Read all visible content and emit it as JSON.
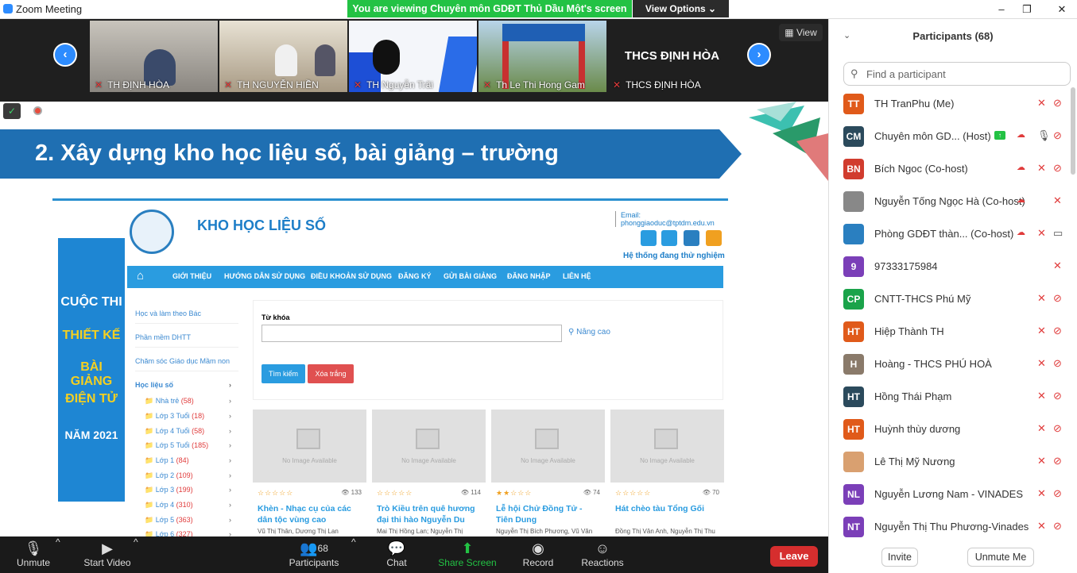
{
  "window": {
    "title": "Zoom Meeting",
    "minimize": "–",
    "maximize": "❐",
    "close": "✕"
  },
  "banner": {
    "text": "You are viewing Chuyên môn GDĐT Thủ Dầu Một's screen",
    "view_options": "View Options ⌄"
  },
  "strip": {
    "view_label": "View",
    "thumbs": [
      {
        "name": "TH ĐỊNH HÒA"
      },
      {
        "name": "TH NGUYỄN HIỀN"
      },
      {
        "name": "TH Nguyễn Trãi"
      },
      {
        "name": "Th Le Thi Hong Gam"
      },
      {
        "name": "THCS ĐỊNH HÒA",
        "big": "THCS ĐỊNH HÒA"
      }
    ]
  },
  "slide": {
    "heading": "2. Xây dựng kho học liệu số, bài giảng – trường",
    "site": {
      "title": "KHO HỌC LIỆU SỐ",
      "email": "Email: phonggiaoduc@tptdm.edu.vn",
      "trial": "Hệ thống đang thử nghiệm",
      "nav": [
        "GIỚI THIỆU",
        "HƯỚNG DẪN SỬ DỤNG",
        "ĐIỀU KHOẢN SỬ DỤNG",
        "ĐĂNG KÝ",
        "GỬI BÀI GIẢNG",
        "ĐĂNG NHẬP",
        "LIÊN HỆ"
      ],
      "banner_lines": [
        "CUỘC THI",
        "THIẾT KẾ",
        "BÀI GIẢNG",
        "ĐIỆN TỬ",
        "NĂM 2021"
      ],
      "left_menu": [
        "Học và làm theo Bác",
        "Phần mềm DHTT",
        "Chăm sóc Giáo dục Mầm non"
      ],
      "cat_title": "Học liệu số",
      "categories": [
        {
          "label": "Nhà trẻ",
          "count": "(58)"
        },
        {
          "label": "Lớp 3 Tuổi",
          "count": "(18)"
        },
        {
          "label": "Lớp 4 Tuổi",
          "count": "(58)"
        },
        {
          "label": "Lớp 5 Tuổi",
          "count": "(185)"
        },
        {
          "label": "Lớp 1",
          "count": "(84)"
        },
        {
          "label": "Lớp 2",
          "count": "(109)"
        },
        {
          "label": "Lớp 3",
          "count": "(199)"
        },
        {
          "label": "Lớp 4",
          "count": "(310)"
        },
        {
          "label": "Lớp 5",
          "count": "(363)"
        },
        {
          "label": "Lớp 6",
          "count": "(327)"
        }
      ],
      "keyword_label": "Từ khóa",
      "advanced": "Nâng cao",
      "search_btn": "Tìm kiếm",
      "clear_btn": "Xóa trắng",
      "no_image": "No Image Available",
      "cards": [
        {
          "title": "Khèn - Nhạc cụ của các dân tộc vùng cao",
          "author": "Vũ Thị Thân, Dương Thị Lan",
          "views": "133",
          "stars": "☆☆☆☆☆"
        },
        {
          "title": "Trò Kiều trên quê hương đại thi hào Nguyễn Du",
          "author": "Mai Thị Hồng Lan; Nguyễn Thị",
          "views": "114",
          "stars": "☆☆☆☆☆"
        },
        {
          "title": "Lễ hội Chử Đồng Tử - Tiên Dung",
          "author": "Nguyễn Thị Bích Phương, Vũ Văn",
          "views": "74",
          "stars": "★★☆☆☆"
        },
        {
          "title": "Hát chèo tàu Tổng Gối",
          "author": "Đồng Thị Vân Anh, Nguyễn Thị Thu Hiền, Lê Thị Hồng Liên",
          "views": "70",
          "stars": "☆☆☆☆☆"
        }
      ]
    }
  },
  "toolbar": {
    "unmute": "Unmute",
    "start_video": "Start Video",
    "participants": "Participants",
    "participants_count": "68",
    "chat": "Chat",
    "share": "Share Screen",
    "record": "Record",
    "reactions": "Reactions",
    "leave": "Leave"
  },
  "panel": {
    "title": "Participants (68)",
    "search_placeholder": "Find a participant",
    "invite": "Invite",
    "unmute_me": "Unmute Me",
    "participants": [
      {
        "initials": "TT",
        "color": "#e05a1a",
        "name": "TH TranPhu (Me)",
        "cam": "off"
      },
      {
        "initials": "CM",
        "color": "#2b4a5c",
        "name": "Chuyên môn GD... (Host)",
        "cam": "off",
        "sharing": true,
        "mic": "on"
      },
      {
        "initials": "BN",
        "color": "#d13c2e",
        "name": "Bích Ngoc (Co-host)",
        "cam": "off"
      },
      {
        "initials": "",
        "color": "#888888",
        "name": "Nguyễn Tống Ngọc Hà (Co-host)",
        "cam": "none"
      },
      {
        "initials": "",
        "color": "#2a7fc0",
        "name": "Phòng GDĐT thàn... (Co-host)",
        "cam": "on"
      },
      {
        "initials": "9",
        "color": "#7b3fb8",
        "name": "97333175984",
        "cam": "none"
      },
      {
        "initials": "CP",
        "color": "#1aa34a",
        "name": "CNTT-THCS Phú Mỹ",
        "cam": "off"
      },
      {
        "initials": "HT",
        "color": "#e05a1a",
        "name": "Hiệp Thành TH",
        "cam": "off"
      },
      {
        "initials": "H",
        "color": "#8a7a6a",
        "name": "Hoàng - THCS PHÚ HOÀ",
        "cam": "off"
      },
      {
        "initials": "HT",
        "color": "#2b4a5c",
        "name": "Hồng Thái Phạm",
        "cam": "off"
      },
      {
        "initials": "HT",
        "color": "#e05a1a",
        "name": "Huỳnh thùy dương",
        "cam": "off"
      },
      {
        "initials": "",
        "color": "#d9a070",
        "name": "Lê Thị Mỹ Nương",
        "cam": "off"
      },
      {
        "initials": "NL",
        "color": "#7b3fb8",
        "name": "Nguyễn Lương Nam - VINADES",
        "cam": "off"
      },
      {
        "initials": "NT",
        "color": "#7b3fb8",
        "name": "Nguyễn Thị Thu Phương-Vinades",
        "cam": "off"
      }
    ]
  }
}
